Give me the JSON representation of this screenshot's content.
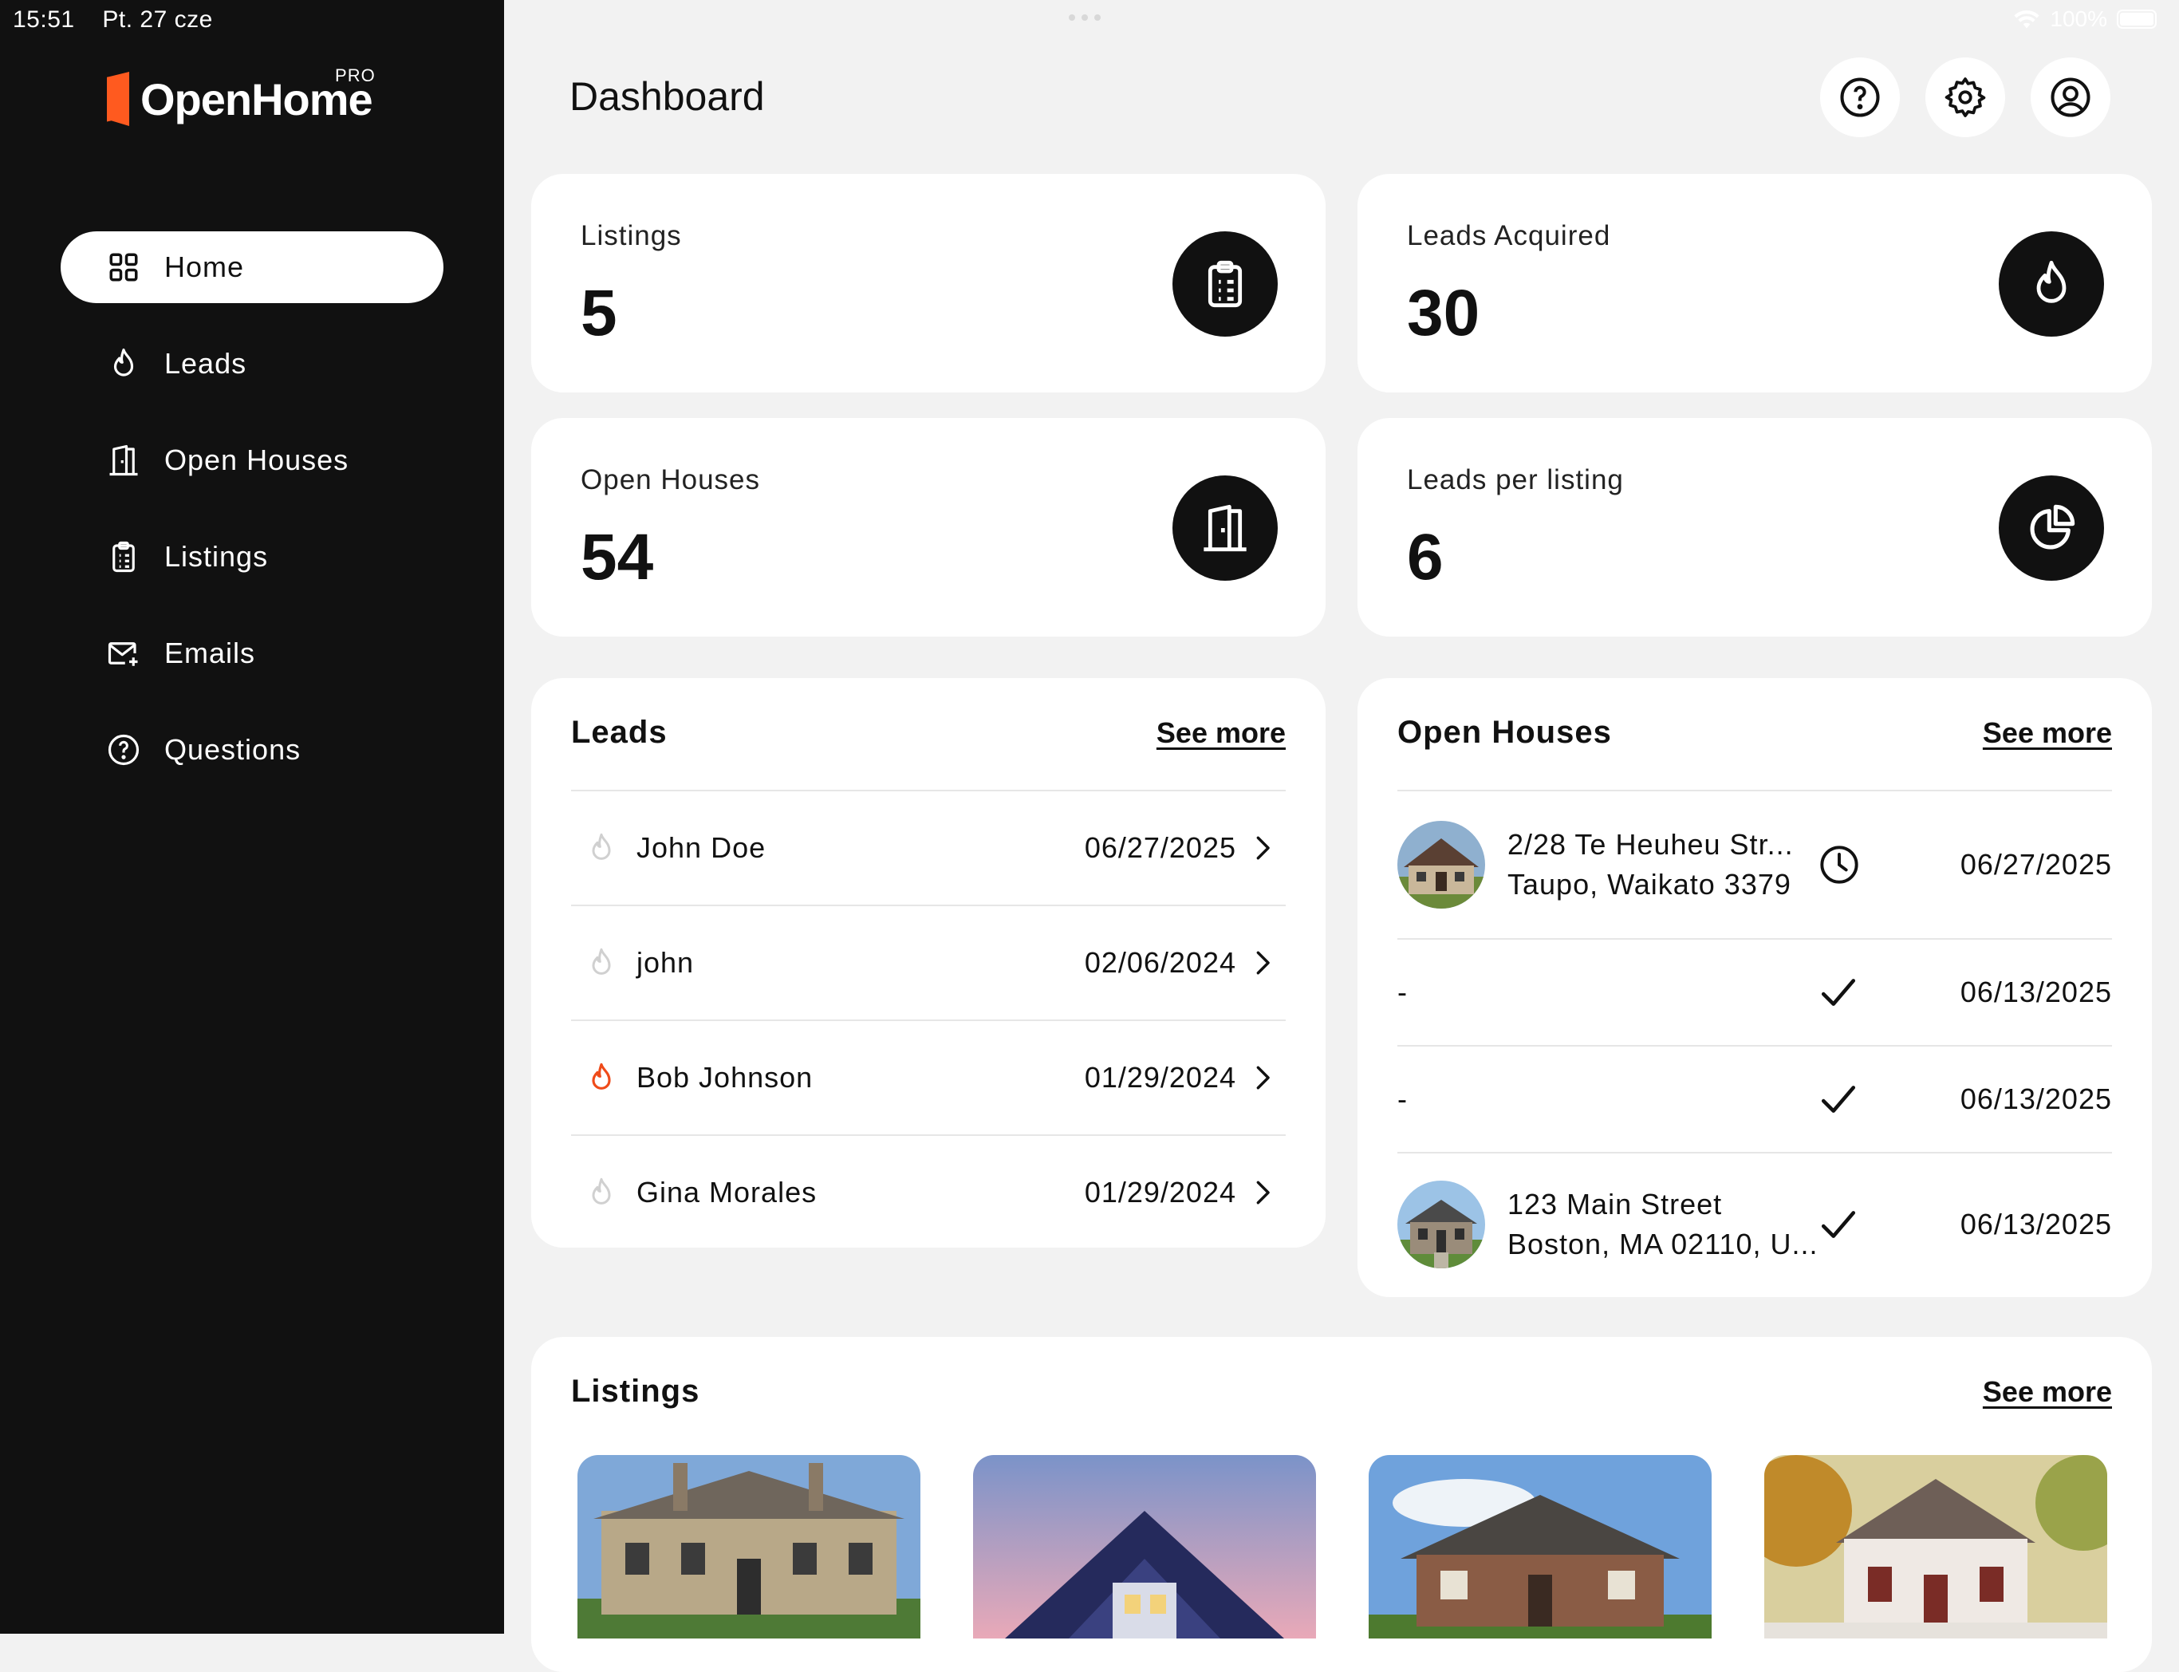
{
  "status_bar": {
    "time": "15:51",
    "date": "Pt. 27 cze",
    "battery": "100%"
  },
  "brand": {
    "name": "OpenHome",
    "badge": "PRO",
    "accent": "#ff5a1f"
  },
  "sidebar": {
    "items": [
      {
        "label": "Home",
        "icon": "grid-icon",
        "active": true
      },
      {
        "label": "Leads",
        "icon": "flame-icon"
      },
      {
        "label": "Open Houses",
        "icon": "door-icon"
      },
      {
        "label": "Listings",
        "icon": "clipboard-icon"
      },
      {
        "label": "Emails",
        "icon": "mail-icon"
      },
      {
        "label": "Questions",
        "icon": "question-icon"
      }
    ]
  },
  "header": {
    "title": "Dashboard",
    "buttons": [
      "help-icon",
      "settings-icon",
      "account-icon"
    ]
  },
  "stats": [
    {
      "label": "Listings",
      "value": "5",
      "icon": "clipboard-icon"
    },
    {
      "label": "Leads Acquired",
      "value": "30",
      "icon": "flame-icon"
    },
    {
      "label": "Open Houses",
      "value": "54",
      "icon": "door-icon"
    },
    {
      "label": "Leads per listing",
      "value": "6",
      "icon": "pie-chart-icon"
    }
  ],
  "leads_panel": {
    "title": "Leads",
    "see_more": "See more",
    "rows": [
      {
        "name": "John Doe",
        "date": "06/27/2025",
        "hot": false
      },
      {
        "name": "john",
        "date": "02/06/2024",
        "hot": false
      },
      {
        "name": "Bob Johnson",
        "date": "01/29/2024",
        "hot": true
      },
      {
        "name": "Gina Morales",
        "date": "01/29/2024",
        "hot": false
      }
    ]
  },
  "open_houses_panel": {
    "title": "Open Houses",
    "see_more": "See more",
    "rows": [
      {
        "line1": "2/28 Te Heuheu Str...",
        "line2": "Taupo, Waikato 3379",
        "status": "clock-icon",
        "date": "06/27/2025",
        "has_photo": true
      },
      {
        "line1": "-",
        "line2": "",
        "status": "check-icon",
        "date": "06/13/2025",
        "has_photo": false
      },
      {
        "line1": "-",
        "line2": "",
        "status": "check-icon",
        "date": "06/13/2025",
        "has_photo": false
      },
      {
        "line1": "123 Main Street",
        "line2": "Boston, MA 02110, U...",
        "status": "check-icon",
        "date": "06/13/2025",
        "has_photo": true
      }
    ]
  },
  "listings_panel": {
    "title": "Listings",
    "see_more": "See more"
  }
}
